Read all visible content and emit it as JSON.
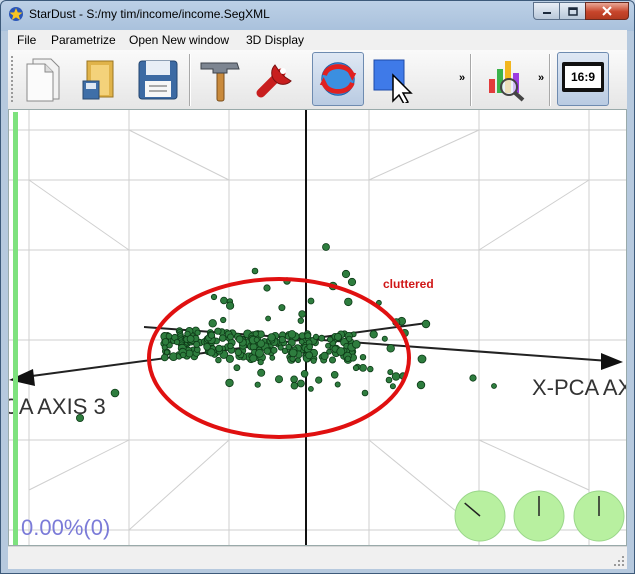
{
  "window": {
    "title": "StarDust - S:/my tim/income/income.SegXML"
  },
  "menu": {
    "items": [
      "File",
      "Parametrize",
      "Open New window",
      "3D Display"
    ]
  },
  "toolbar": {
    "more1": "»",
    "more2": "»",
    "aspect_label": "16:9"
  },
  "plot": {
    "x_axis_label": "X-PCA AX",
    "z_axis_label": "CA AXIS 3",
    "annotation": "cluttered",
    "progress_text": "0.00%(0)",
    "progress_fraction": 0.0,
    "colors": {
      "points": "#2e7d3e",
      "ellipse": "#e01010",
      "annotation": "#d01818",
      "progress": "#7ee27e",
      "percent_text": "#7b7bd8",
      "grid": "#cfcfcf",
      "dials": "#b8f0a0"
    },
    "dials": [
      {
        "name": "dial-1",
        "angle_deg": -50
      },
      {
        "name": "dial-2",
        "angle_deg": 0
      },
      {
        "name": "dial-3",
        "angle_deg": 0
      }
    ]
  }
}
